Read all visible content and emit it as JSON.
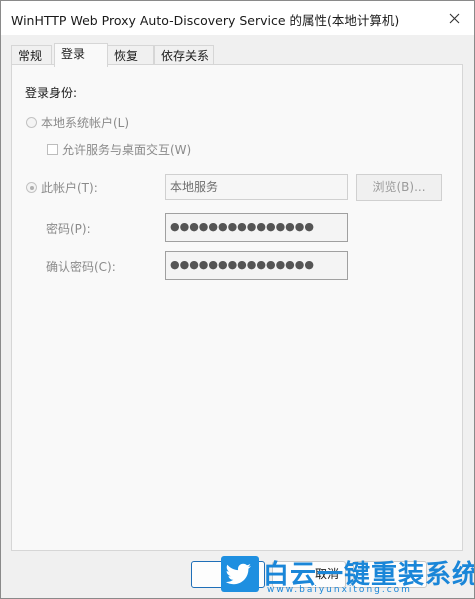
{
  "window": {
    "title": "WinHTTP Web Proxy Auto-Discovery Service 的属性(本地计算机)"
  },
  "tabs": [
    {
      "label": "常规"
    },
    {
      "label": "登录"
    },
    {
      "label": "恢复"
    },
    {
      "label": "依存关系"
    }
  ],
  "logon": {
    "group_label": "登录身份:",
    "local_system_label": "本地系统帐户(L)",
    "interact_label": "允许服务与桌面交互(W)",
    "this_account_label": "此帐户(T):",
    "account_value": "本地服务",
    "browse_label": "浏览(B)...",
    "password_label": "密码(P):",
    "password_value": "●●●●●●●●●●●●●●●",
    "confirm_label": "确认密码(C):",
    "confirm_value": "●●●●●●●●●●●●●●●"
  },
  "buttons": {
    "cancel_label": "取消"
  },
  "watermark": {
    "brand": "白云一键重装系统",
    "url": "www.baiyunxitong.com"
  },
  "colors": {
    "accent": "#1f6fb8",
    "watermark": "#1a86d8"
  }
}
